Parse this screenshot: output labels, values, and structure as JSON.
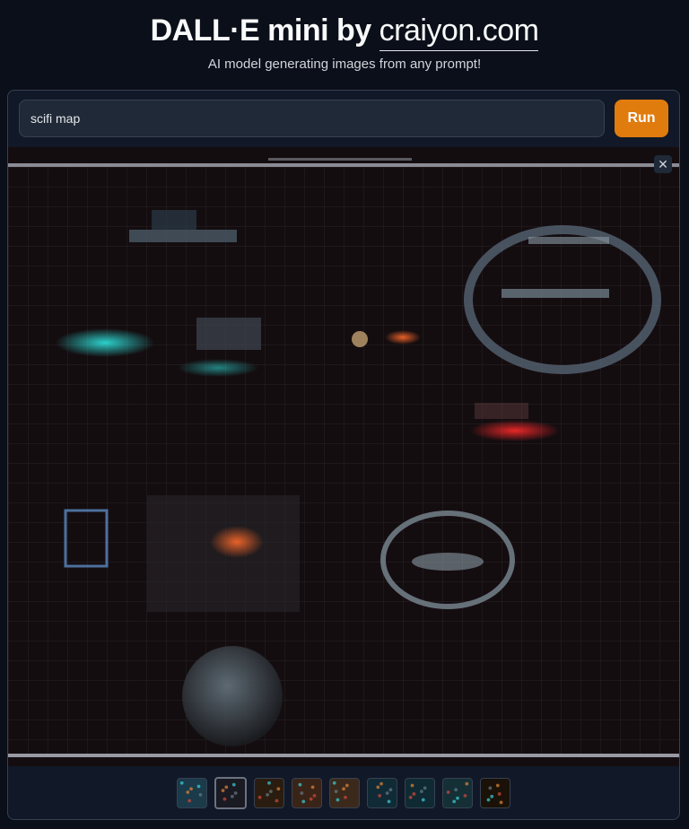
{
  "header": {
    "title_prefix": "DALL·E mini by",
    "title_link": "craiyon.com",
    "subtitle": "AI model generating images from any prompt!"
  },
  "prompt": {
    "value": "scifi map",
    "run_label": "Run"
  },
  "gallery": {
    "close_symbol": "✕",
    "selected_index": 1,
    "thumbnail_count": 9,
    "thumbnails": [
      {
        "color": "#1b3a4a"
      },
      {
        "color": "#1a1a22"
      },
      {
        "color": "#2a1d10"
      },
      {
        "color": "#3a2418"
      },
      {
        "color": "#3b2a1c"
      },
      {
        "color": "#102a36"
      },
      {
        "color": "#0f2a33"
      },
      {
        "color": "#143036"
      },
      {
        "color": "#1a1208"
      }
    ]
  },
  "colors": {
    "accent": "#e07b0e",
    "background": "#0b0f19",
    "panel": "#111827"
  }
}
